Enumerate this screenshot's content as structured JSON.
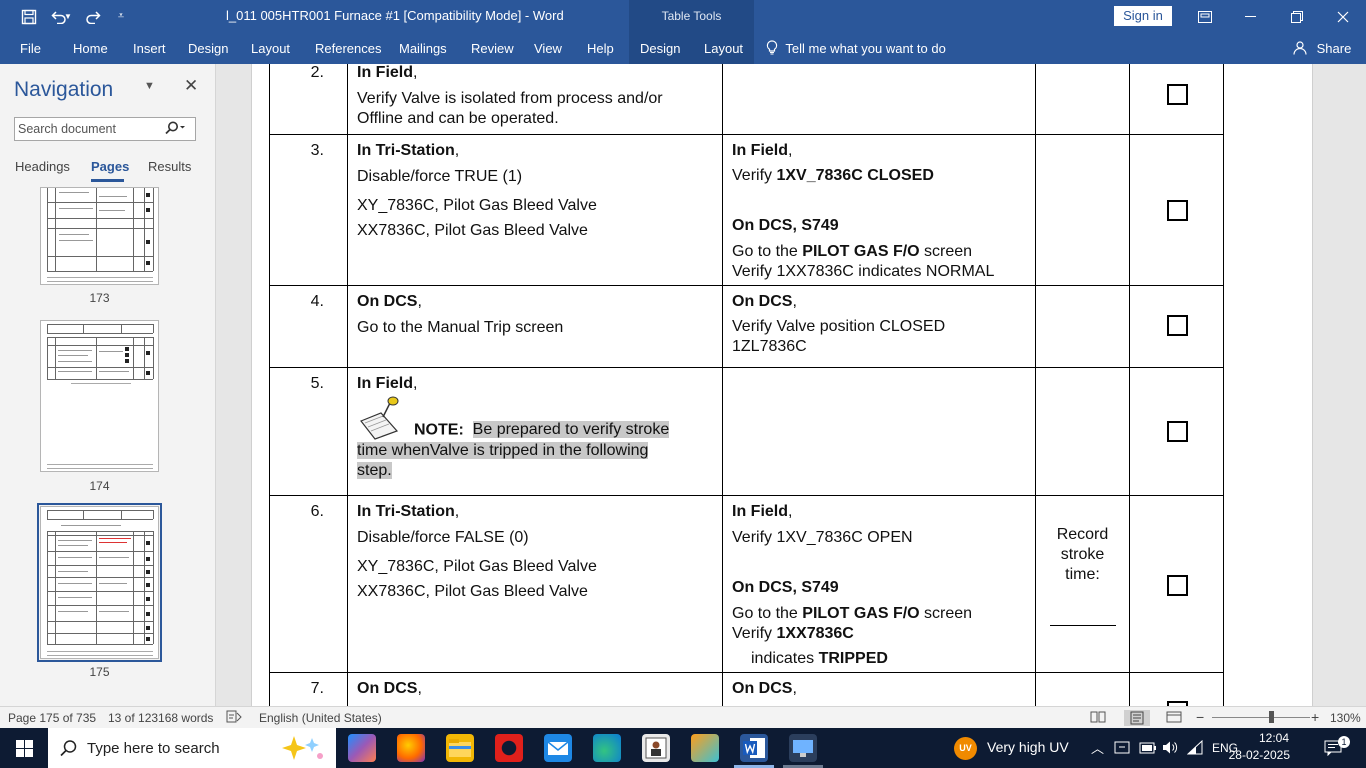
{
  "titlebar": {
    "doc_title": "l_011 005HTR001 Furnace #1  [Compatibility Mode]  -  Word",
    "contextual_group": "Table Tools",
    "signin": "Sign in"
  },
  "ribbon": {
    "tabs": [
      "File",
      "Home",
      "Insert",
      "Design",
      "Layout",
      "References",
      "Mailings",
      "Review",
      "View",
      "Help",
      "Design",
      "Layout"
    ],
    "tell_me": "Tell me what you want to do",
    "share": "Share"
  },
  "navigation": {
    "title": "Navigation",
    "search_placeholder": "Search document",
    "tabs": [
      "Headings",
      "Pages",
      "Results"
    ],
    "active_tab": "Pages",
    "thumbnails": [
      {
        "label": "173"
      },
      {
        "label": "174"
      },
      {
        "label": "175",
        "selected": true
      }
    ]
  },
  "table": {
    "rows": [
      {
        "num": "2.",
        "col1": {
          "head": "In Field",
          "head_suffix": ",",
          "lines": [
            "Verify Valve is isolated from process and/or",
            "Offline and can be operated."
          ]
        },
        "col2": {},
        "col3": ""
      },
      {
        "num": "3.",
        "col1": {
          "head": "In Tri-Station",
          "head_suffix": ",",
          "line1": "Disable/force TRUE (1)",
          "lines": [
            "XY_7836C, Pilot Gas Bleed Valve",
            "XX7836C, Pilot Gas Bleed Valve"
          ]
        },
        "col2": {
          "head": "In Field",
          "head_suffix": ",",
          "verify_prefix": "Verify ",
          "verify_bold": "1XV_7836C CLOSED",
          "head2": "On DCS, S749",
          "goto_prefix": "Go to the ",
          "goto_bold": "PILOT GAS F/O",
          "goto_suffix": " screen",
          "line_last": "Verify 1XX7836C indicates NORMAL"
        },
        "col3": ""
      },
      {
        "num": "4.",
        "col1": {
          "head": "On DCS",
          "head_suffix": ",",
          "line1": "Go to the Manual Trip screen"
        },
        "col2": {
          "head": "On DCS",
          "head_suffix": ",",
          "lines": [
            "Verify Valve position CLOSED",
            "1ZL7836C"
          ]
        },
        "col3": ""
      },
      {
        "num": "5.",
        "col1": {
          "head": "In Field",
          "head_suffix": ",",
          "note_label": "NOTE:",
          "note_text_1": "Be prepared to verify stroke",
          "note_text_2": "time whenValve is tripped in the following",
          "note_text_3": "step."
        },
        "col2": {},
        "col3": ""
      },
      {
        "num": "6.",
        "col1": {
          "head": "In Tri-Station",
          "head_suffix": ",",
          "line1": "Disable/force FALSE (0)",
          "lines": [
            "XY_7836C, Pilot Gas Bleed Valve",
            "XX7836C, Pilot Gas Bleed Valve"
          ]
        },
        "col2": {
          "head": "In Field",
          "head_suffix": ",",
          "line1": "Verify 1XV_7836C OPEN",
          "head2": "On DCS, S749",
          "goto_prefix": "Go to the ",
          "goto_bold": "PILOT GAS F/O",
          "goto_suffix": " screen",
          "verify_prefix": "Verify ",
          "verify_bold": "1XX7836C",
          "ind_prefix": "indicates ",
          "ind_bold": "TRIPPED"
        },
        "col3": "Record stroke time:"
      },
      {
        "num": "7.",
        "col1": {
          "head": "On DCS",
          "head_suffix": ","
        },
        "col2": {
          "head": "On DCS",
          "head_suffix": ","
        },
        "col3": ""
      }
    ]
  },
  "status": {
    "page": "Page 175 of 735",
    "words": "13 of 123168 words",
    "language": "English (United States)",
    "zoom": "130%",
    "zoom_level": 0.6
  },
  "taskbar": {
    "search_placeholder": "Type here to search",
    "weather": "Very high UV",
    "weather_badge": "UV",
    "lang": "ENG",
    "time": "12:04",
    "date": "28-02-2025"
  },
  "colors": {
    "word_blue": "#2b579a",
    "taskbar": "#0d1b33",
    "selection": "#c8c8c8"
  }
}
